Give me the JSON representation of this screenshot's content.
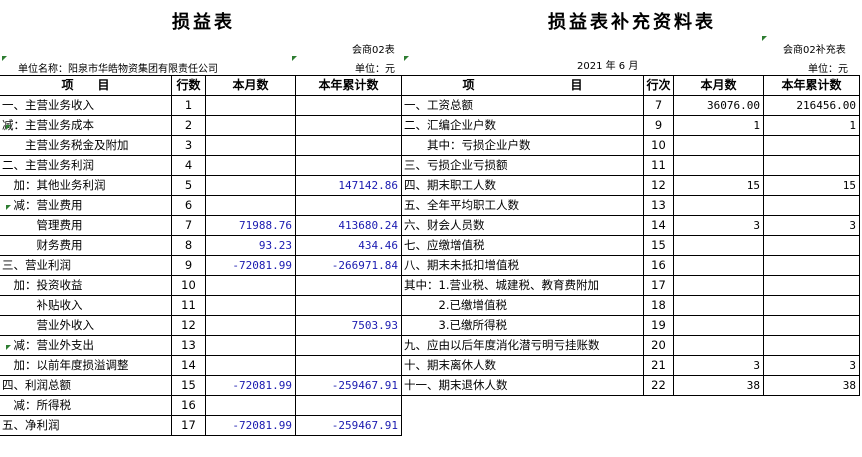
{
  "left": {
    "title": "损益表",
    "code": "会商02表",
    "unit_name": "单位名称：阳泉市华皓物资集团有限责任公司",
    "unit": "单位：元",
    "headers": {
      "item": "项　　目",
      "row": "行数",
      "month": "本月数",
      "ytd": "本年累计数"
    },
    "rows": [
      {
        "label": "一、主营业务收入",
        "no": "1",
        "month": "",
        "ytd": ""
      },
      {
        "label": "减：主营业务成本",
        "no": "2",
        "month": "",
        "ytd": ""
      },
      {
        "label": "　　主营业务税金及附加",
        "no": "3",
        "month": "",
        "ytd": ""
      },
      {
        "label": "二、主营业务利润",
        "no": "4",
        "month": "",
        "ytd": ""
      },
      {
        "label": "　加：其他业务利润",
        "no": "5",
        "month": "",
        "ytd": "147142.86"
      },
      {
        "label": "　减：营业费用",
        "no": "6",
        "month": "",
        "ytd": ""
      },
      {
        "label": "　　　管理费用",
        "no": "7",
        "month": "71988.76",
        "ytd": "413680.24"
      },
      {
        "label": "　　　财务费用",
        "no": "8",
        "month": "93.23",
        "ytd": "434.46"
      },
      {
        "label": "三、营业利润",
        "no": "9",
        "month": "-72081.99",
        "ytd": "-266971.84"
      },
      {
        "label": "　加：投资收益",
        "no": "10",
        "month": "",
        "ytd": ""
      },
      {
        "label": "　　　补贴收入",
        "no": "11",
        "month": "",
        "ytd": ""
      },
      {
        "label": "　　　营业外收入",
        "no": "12",
        "month": "",
        "ytd": "7503.93"
      },
      {
        "label": "　减：营业外支出",
        "no": "13",
        "month": "",
        "ytd": ""
      },
      {
        "label": "　加：以前年度损溢调整",
        "no": "14",
        "month": "",
        "ytd": ""
      },
      {
        "label": "四、利润总额",
        "no": "15",
        "month": "-72081.99",
        "ytd": "-259467.91"
      },
      {
        "label": "　减：所得税",
        "no": "16",
        "month": "",
        "ytd": ""
      },
      {
        "label": "五、净利润",
        "no": "17",
        "month": "-72081.99",
        "ytd": "-259467.91"
      }
    ]
  },
  "right": {
    "title": "损益表补充资料表",
    "code": "会商02补充表",
    "date": "2021 年 6 月",
    "unit": "单位：元",
    "headers": {
      "item": "项　　　　　　　　目",
      "row": "行次",
      "month": "本月数",
      "ytd": "本年累计数"
    },
    "rows": [
      {
        "label": "一、工资总额",
        "no": "7",
        "month": "36076.00",
        "ytd": "216456.00"
      },
      {
        "label": "二、汇编企业户数",
        "no": "9",
        "month": "1",
        "ytd": "1"
      },
      {
        "label": "　　其中：亏损企业户数",
        "no": "10",
        "month": "",
        "ytd": ""
      },
      {
        "label": "三、亏损企业亏损额",
        "no": "11",
        "month": "",
        "ytd": ""
      },
      {
        "label": "四、期末职工人数",
        "no": "12",
        "month": "15",
        "ytd": "15"
      },
      {
        "label": "五、全年平均职工人数",
        "no": "13",
        "month": "",
        "ytd": ""
      },
      {
        "label": "六、财会人员数",
        "no": "14",
        "month": "3",
        "ytd": "3"
      },
      {
        "label": "七、应缴增值税",
        "no": "15",
        "month": "",
        "ytd": ""
      },
      {
        "label": "八、期末未抵扣增值税",
        "no": "16",
        "month": "",
        "ytd": ""
      },
      {
        "label": "其中：1.营业税、城建税、教育费附加",
        "no": "17",
        "month": "",
        "ytd": ""
      },
      {
        "label": "　　　2.已缴增值税",
        "no": "18",
        "month": "",
        "ytd": ""
      },
      {
        "label": "　　　3.已缴所得税",
        "no": "19",
        "month": "",
        "ytd": ""
      },
      {
        "label": "九、应由以后年度消化潜亏明亏挂账数",
        "no": "20",
        "month": "",
        "ytd": ""
      },
      {
        "label": "十、期末离休人数",
        "no": "21",
        "month": "3",
        "ytd": "3"
      },
      {
        "label": "十一、期末退休人数",
        "no": "22",
        "month": "38",
        "ytd": "38"
      }
    ]
  }
}
